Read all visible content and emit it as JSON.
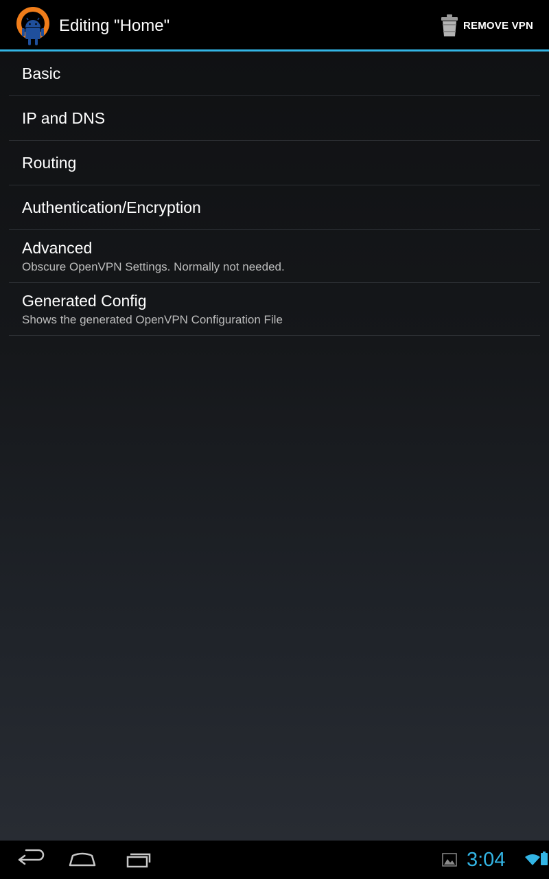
{
  "action_bar": {
    "title": "Editing \"Home\"",
    "app_icon": "openvpn-android-icon",
    "remove_button": {
      "label": "REMOVE VPN",
      "icon": "trash-icon"
    },
    "accent_color": "#33b5e5"
  },
  "preferences": [
    {
      "title": "Basic",
      "summary": ""
    },
    {
      "title": "IP and DNS",
      "summary": ""
    },
    {
      "title": "Routing",
      "summary": ""
    },
    {
      "title": "Authentication/Encryption",
      "summary": ""
    },
    {
      "title": "Advanced",
      "summary": "Obscure OpenVPN Settings. Normally not needed."
    },
    {
      "title": "Generated Config",
      "summary": "Shows the generated OpenVPN Configuration File"
    }
  ],
  "nav_bar": {
    "buttons": [
      "back-icon",
      "home-icon",
      "recent-apps-icon"
    ]
  },
  "status_bar": {
    "time": "3:04",
    "icons": [
      "gallery-notification-icon",
      "wifi-icon",
      "battery-icon"
    ],
    "time_color": "#33b5e5"
  }
}
